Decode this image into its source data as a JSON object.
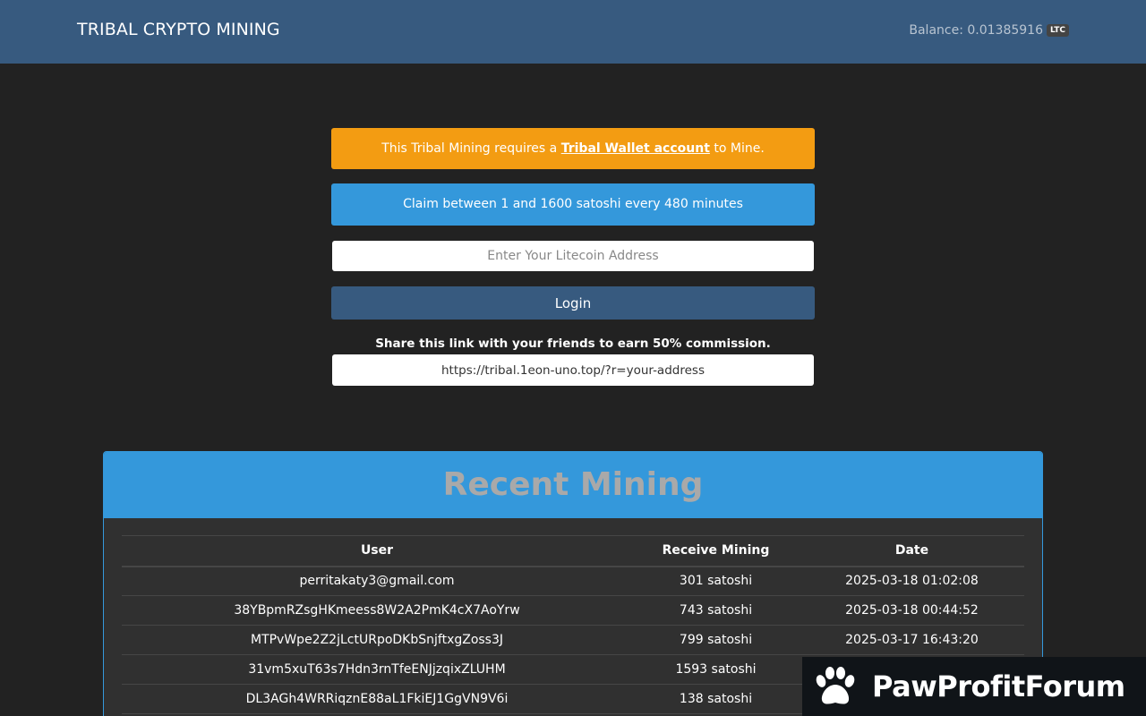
{
  "header": {
    "brand": "TRIBAL CRYPTO MINING",
    "balance_label": "Balance: 0.01385916",
    "currency": "LTC"
  },
  "notice": {
    "prefix": "This Tribal Mining requires a ",
    "link": "Tribal Wallet account",
    "suffix": " to Mine."
  },
  "claim_info": "Claim between 1 and 1600 satoshi every 480 minutes",
  "address_input": {
    "placeholder": "Enter Your Litecoin Address",
    "value": ""
  },
  "login_label": "Login",
  "share": {
    "text": "Share this link with your friends to earn 50% commission.",
    "link": "https://tribal.1eon-uno.top/?r=your-address"
  },
  "recent": {
    "title": "Recent Mining",
    "columns": [
      "User",
      "Receive Mining",
      "Date"
    ],
    "rows": [
      [
        "perritakaty3@gmail.com",
        "301 satoshi",
        "2025-03-18 01:02:08"
      ],
      [
        "38YBpmRZsgHKmeess8W2A2PmK4cX7AoYrw",
        "743 satoshi",
        "2025-03-18 00:44:52"
      ],
      [
        "MTPvWpe2Z2jLctURpoDKbSnjftxgZoss3J",
        "799 satoshi",
        "2025-03-17 16:43:20"
      ],
      [
        "31vm5xuT63s7Hdn3rnTfeENJjzqixZLUHM",
        "1593 satoshi",
        ""
      ],
      [
        "DL3AGh4WRRiqznE88aL1FkiEJ1GgVN9V6i",
        "138 satoshi",
        ""
      ]
    ]
  },
  "watermark": {
    "text": "PawProfitForum",
    "icon": "paw-icon"
  },
  "colors": {
    "navbar": "#375a7f",
    "warning": "#f39c12",
    "info": "#3498db",
    "background": "#222222"
  }
}
